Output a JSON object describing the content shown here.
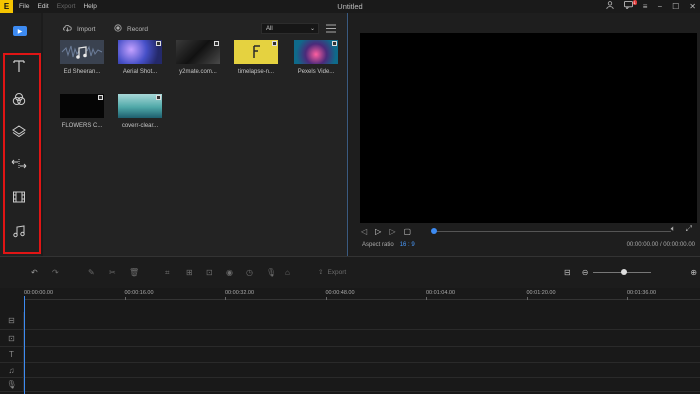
{
  "app": {
    "title": "Untitled",
    "logo_text": "E",
    "menu": [
      {
        "label": "File",
        "enabled": true
      },
      {
        "label": "Edit",
        "enabled": true
      },
      {
        "label": "Export",
        "enabled": false
      },
      {
        "label": "Help",
        "enabled": true
      }
    ],
    "notification_count": "1"
  },
  "rail": {
    "media_tab_icon": "media-icon",
    "items": [
      {
        "name": "text",
        "icon": "text-icon"
      },
      {
        "name": "filters",
        "icon": "filters-icon"
      },
      {
        "name": "overlays",
        "icon": "overlays-icon"
      },
      {
        "name": "transitions",
        "icon": "transitions-icon"
      },
      {
        "name": "elements",
        "icon": "film-icon"
      },
      {
        "name": "music",
        "icon": "music-icon"
      }
    ],
    "highlight_color": "#e01515"
  },
  "library": {
    "import_label": "Import",
    "record_label": "Record",
    "filter_value": "All",
    "items": [
      {
        "label": "Ed Sheeran...",
        "kind": "audio"
      },
      {
        "label": "Aerial Shot...",
        "kind": "video"
      },
      {
        "label": "y2mate.com...",
        "kind": "video"
      },
      {
        "label": "timelapse-n...",
        "kind": "video"
      },
      {
        "label": "Pexels Vide...",
        "kind": "video"
      },
      {
        "label": "FLOWERS C...",
        "kind": "video"
      },
      {
        "label": "coverr-clear...",
        "kind": "video"
      }
    ]
  },
  "preview": {
    "aspect_label": "Aspect ratio",
    "aspect_value": "16 : 9",
    "time": "00:00:00.00 / 00:00:00.00",
    "progress": 0
  },
  "toolbar": {
    "export_label": "Export",
    "zoom_level": 0.52
  },
  "timeline": {
    "ticks": [
      "00:00:00.00",
      "00:00:16.00",
      "00:00:32.00",
      "00:00:48.00",
      "00:01:04.00",
      "00:01:20.00",
      "00:01:36.00"
    ],
    "tracks": [
      {
        "name": "video-track",
        "icon": "video-track-icon"
      },
      {
        "name": "pip-track",
        "icon": "pip-track-icon"
      },
      {
        "name": "text-track",
        "icon": "text-track-icon"
      },
      {
        "name": "music-track",
        "icon": "music-track-icon"
      },
      {
        "name": "voice-track",
        "icon": "mic-track-icon"
      }
    ]
  },
  "colors": {
    "accent": "#3d8bf2",
    "background": "#1c1c1c"
  }
}
